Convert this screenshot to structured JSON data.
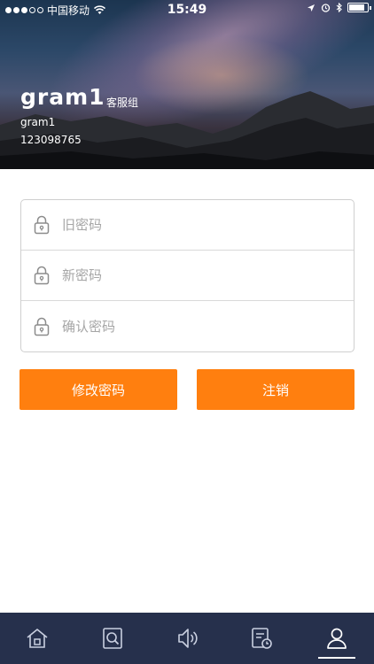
{
  "status_bar": {
    "carrier": "中国移动",
    "time": "15:49",
    "signal_dots_filled": 3,
    "signal_dots_total": 5,
    "battery_level": 0.85
  },
  "profile": {
    "username": "gram1",
    "group": "客服组",
    "account": "gram1",
    "phone": "123098765"
  },
  "form": {
    "old_password_placeholder": "旧密码",
    "new_password_placeholder": "新密码",
    "confirm_password_placeholder": "确认密码"
  },
  "buttons": {
    "change_password": "修改密码",
    "logout": "注销"
  },
  "tabbar": {
    "items": [
      {
        "icon": "home-icon",
        "active": false
      },
      {
        "icon": "search-document-icon",
        "active": false
      },
      {
        "icon": "speaker-icon",
        "active": false
      },
      {
        "icon": "history-document-icon",
        "active": false
      },
      {
        "icon": "user-icon",
        "active": true
      }
    ]
  },
  "colors": {
    "accent": "#ff7f0f",
    "tabbar_bg": "#26304c",
    "placeholder": "#a6a6a6"
  }
}
